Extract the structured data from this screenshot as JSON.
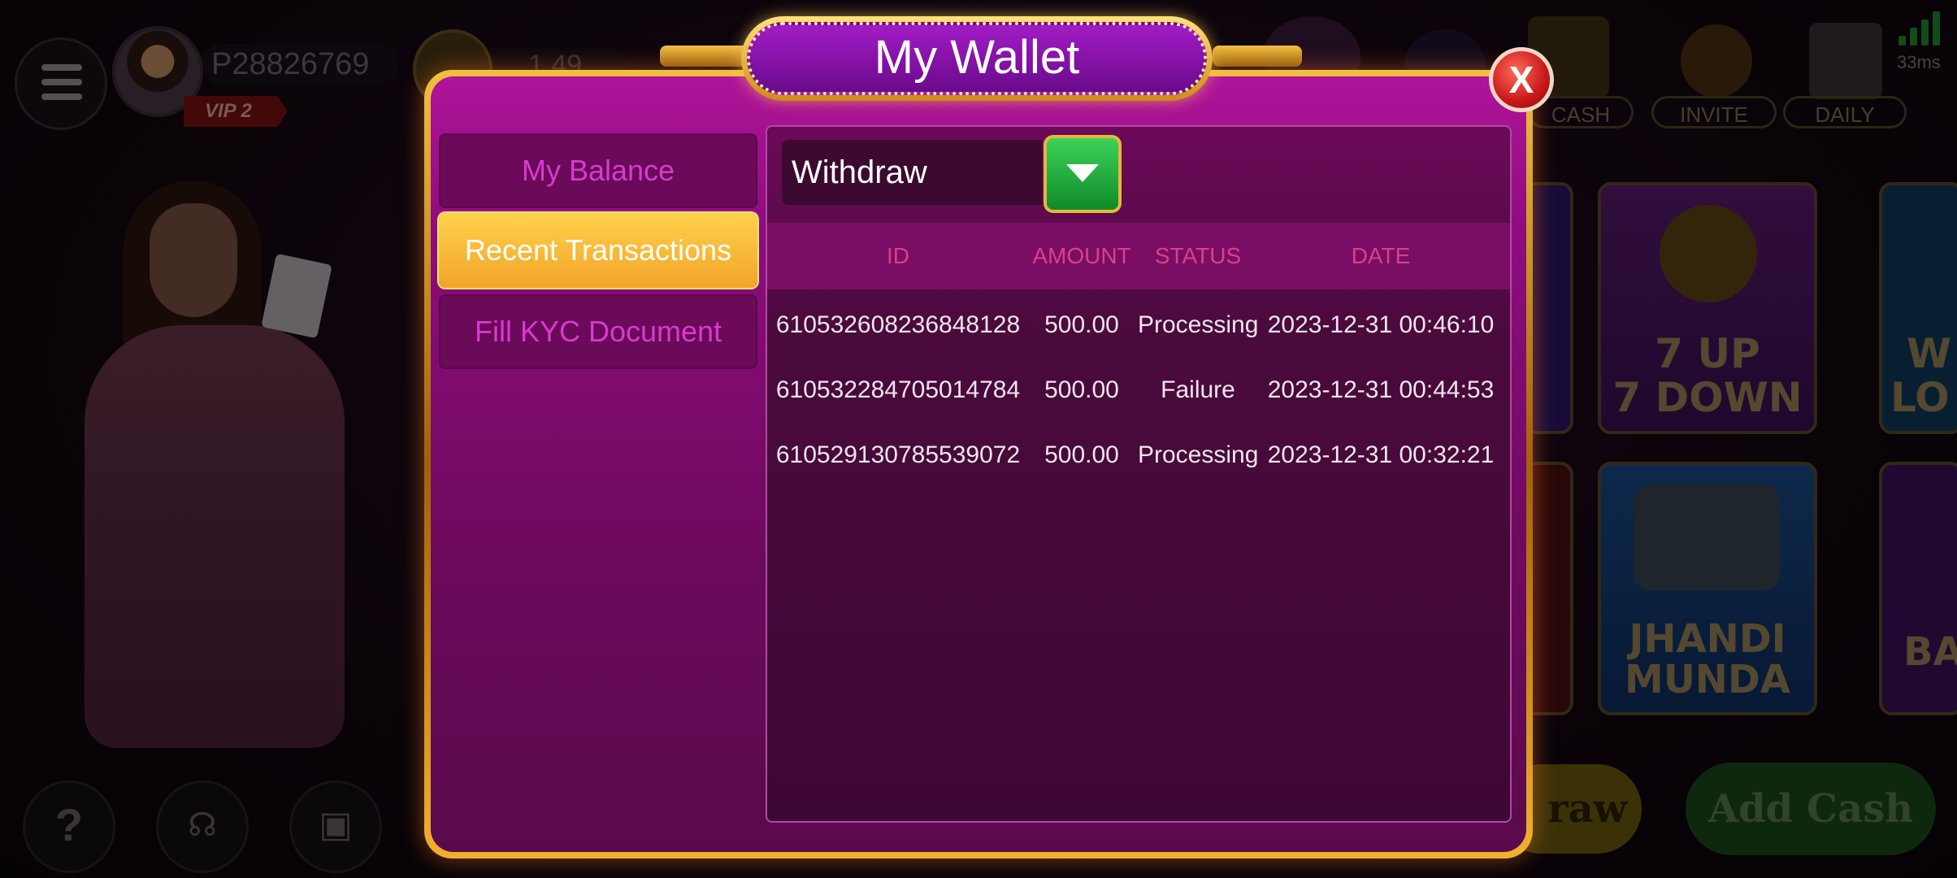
{
  "header": {
    "player_id": "P28826769",
    "vip_label": "VIP 2",
    "coin_amount": "1.49",
    "ping": "33ms",
    "pills": {
      "cash": "CASH",
      "invite": "INVITE",
      "daily": "DAILY"
    }
  },
  "games": {
    "seven_up_line1": "7 UP",
    "seven_up_line2": "7 DOWN",
    "jhandi_line1": "JHANDI",
    "jhandi_line2": "MUNDA",
    "partial_top_right": "W",
    "partial_top_right2": "LO",
    "partial_bottom_right": "BA"
  },
  "bottom": {
    "withdraw_partial": "raw",
    "add_cash": "Add Cash",
    "help_icon": "?"
  },
  "wallet": {
    "title": "My Wallet",
    "close_label": "X",
    "nav": [
      {
        "label": "My Balance"
      },
      {
        "label": "Recent Transactions"
      },
      {
        "label": "Fill KYC Document"
      }
    ],
    "filter": {
      "selected": "Withdraw"
    },
    "table": {
      "headers": {
        "id": "ID",
        "amount": "AMOUNT",
        "status": "STATUS",
        "date": "DATE"
      },
      "rows": [
        {
          "id": "610532608236848128",
          "amount": "500.00",
          "status": "Processing",
          "date": "2023-12-31 00:46:10"
        },
        {
          "id": "610532284705014784",
          "amount": "500.00",
          "status": "Failure",
          "date": "2023-12-31 00:44:53"
        },
        {
          "id": "610529130785539072",
          "amount": "500.00",
          "status": "Processing",
          "date": "2023-12-31 00:32:21"
        }
      ]
    }
  }
}
